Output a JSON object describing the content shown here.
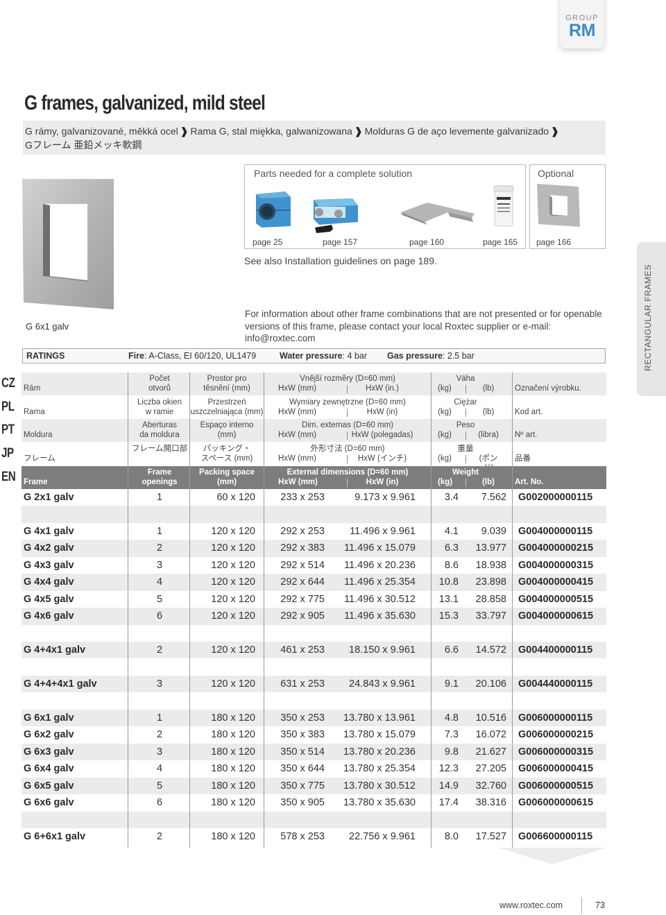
{
  "group_badge": {
    "label": "GROUP",
    "code": "RM"
  },
  "title": "G frames, galvanized, mild steel",
  "subtitle": {
    "segments": [
      "G rámy, galvanizované, měkká ocel",
      "Rama G, stal miękka, galwanizowana",
      "Molduras G de aço levemente galvanizado"
    ],
    "separator": "❱",
    "line2": "Gフレーム 亜鉛メッキ軟鋼"
  },
  "parts": {
    "title": "Parts needed for a complete solution",
    "items": [
      {
        "icon": "blue-block-module-icon",
        "page": "page 25"
      },
      {
        "icon": "blue-compression-unit-icon",
        "page": "page 157"
      },
      {
        "icon": "stayplate-icon",
        "page": "page 160"
      },
      {
        "icon": "lubricant-jar-icon",
        "page": "page 165"
      }
    ]
  },
  "optional": {
    "title": "Optional",
    "items": [
      {
        "icon": "weld-frame-icon",
        "page": "page 166"
      }
    ]
  },
  "frame_image_label": "G 6x1 galv",
  "see_also": "See also Installation guidelines on page 189.",
  "info_text": "For information about other frame combinations that are not presented or for openable versions of this frame, please contact your local Roxtec supplier or e-mail: info@roxtec.com",
  "ratings": {
    "label": "RATINGS",
    "fire_label": "Fire",
    "fire_value": ": A-Class, EI 60/120, UL1479",
    "water_label": "Water pressure",
    "water_value": ": 4 bar",
    "gas_label": "Gas pressure",
    "gas_value": ": 2.5 bar"
  },
  "side_tab": "RECTANGULAR FRAMES",
  "languages": [
    "CZ",
    "PL",
    "PT",
    "JP",
    "EN"
  ],
  "header_rows": [
    {
      "lang": "CZ",
      "frame": "Rám",
      "openings": [
        "Počet",
        "otvorů"
      ],
      "packing": [
        "Prostor pro",
        "těsnění (mm)"
      ],
      "ext_title": "Vnější rozměry (D=60 mm)",
      "ext_mm": "HxW (mm)",
      "ext_in": "HxW (in.)",
      "weight_title": "Váha",
      "kg": "(kg)",
      "lb": "(lb)",
      "art": "Označení výrobku."
    },
    {
      "lang": "PL",
      "frame": "Rama",
      "openings": [
        "Liczba okien",
        "w ramie"
      ],
      "packing": [
        "Przestrzeń",
        "uszczelniająca (mm)"
      ],
      "ext_title": "Wymiary zewnętrzne (D=60 mm)",
      "ext_mm": "HxW (mm)",
      "ext_in": "HxW (in)",
      "weight_title": "Ciężar",
      "kg": "(kg)",
      "lb": "(lb)",
      "art": "Kod art."
    },
    {
      "lang": "PT",
      "frame": "Moldura",
      "openings": [
        "Aberturas",
        "da moldura"
      ],
      "packing": [
        "Espaço interno",
        "(mm)"
      ],
      "ext_title": "Dim. externas (D=60 mm)",
      "ext_mm": "HxW (mm)",
      "ext_in": "HxW (polegadas)",
      "weight_title": "Peso",
      "kg": "(kg)",
      "lb": "(libra)",
      "art": "Nº art."
    },
    {
      "lang": "JP",
      "frame": "フレーム",
      "openings": [
        "",
        "フレーム開口部"
      ],
      "packing": [
        "パッキング・",
        "スペース (mm)"
      ],
      "ext_title": "外形寸法 (D=60 mm)",
      "ext_mm": "HxW (mm)",
      "ext_in": "HxW (インチ)",
      "weight_title": "重量",
      "kg": "(kg)",
      "lb": "(ポンド)",
      "art": "品番"
    },
    {
      "lang": "EN",
      "frame": "Frame",
      "openings": [
        "Frame",
        "openings"
      ],
      "packing": [
        "Packing space",
        "(mm)"
      ],
      "ext_title": "External dimensions (D=60 mm)",
      "ext_mm": "HxW (mm)",
      "ext_in": "HxW (in)",
      "weight_title": "Weight",
      "kg": "(kg)",
      "lb": "(lb)",
      "art": "Art. No."
    }
  ],
  "rows": [
    {
      "name": "G 2x1 galv",
      "openings": "1",
      "packing": "60 x 120",
      "mm": "233 x 253",
      "in": "9.173 x 9.961",
      "kg": "3.4",
      "lb": "7.562",
      "art": "G002000000115"
    },
    null,
    {
      "name": "G 4x1 galv",
      "openings": "1",
      "packing": "120 x 120",
      "mm": "292 x 253",
      "in": "11.496 x 9.961",
      "kg": "4.1",
      "lb": "9.039",
      "art": "G004000000115"
    },
    {
      "name": "G 4x2 galv",
      "openings": "2",
      "packing": "120 x 120",
      "mm": "292 x 383",
      "in": "11.496 x 15.079",
      "kg": "6.3",
      "lb": "13.977",
      "art": "G004000000215"
    },
    {
      "name": "G 4x3 galv",
      "openings": "3",
      "packing": "120 x 120",
      "mm": "292 x 514",
      "in": "11.496 x 20.236",
      "kg": "8.6",
      "lb": "18.938",
      "art": "G004000000315"
    },
    {
      "name": "G 4x4 galv",
      "openings": "4",
      "packing": "120 x 120",
      "mm": "292 x 644",
      "in": "11.496 x 25.354",
      "kg": "10.8",
      "lb": "23.898",
      "art": "G004000000415"
    },
    {
      "name": "G 4x5 galv",
      "openings": "5",
      "packing": "120 x 120",
      "mm": "292 x 775",
      "in": "11.496 x 30.512",
      "kg": "13.1",
      "lb": "28.858",
      "art": "G004000000515"
    },
    {
      "name": "G 4x6 galv",
      "openings": "6",
      "packing": "120 x 120",
      "mm": "292 x 905",
      "in": "11.496 x 35.630",
      "kg": "15.3",
      "lb": "33.797",
      "art": "G004000000615"
    },
    null,
    {
      "name": "G 4+4x1 galv",
      "openings": "2",
      "packing": "120 x 120",
      "mm": "461 x 253",
      "in": "18.150 x 9.961",
      "kg": "6.6",
      "lb": "14.572",
      "art": "G004400000115"
    },
    null,
    {
      "name": "G 4+4+4x1 galv",
      "openings": "3",
      "packing": "120 x 120",
      "mm": "631 x 253",
      "in": "24.843 x 9.961",
      "kg": "9.1",
      "lb": "20.106",
      "art": "G004440000115"
    },
    null,
    {
      "name": "G 6x1 galv",
      "openings": "1",
      "packing": "180 x 120",
      "mm": "350 x 253",
      "in": "13.780 x 13.961",
      "kg": "4.8",
      "lb": "10.516",
      "art": "G006000000115"
    },
    {
      "name": "G 6x2 galv",
      "openings": "2",
      "packing": "180 x 120",
      "mm": "350 x 383",
      "in": "13.780 x 15.079",
      "kg": "7.3",
      "lb": "16.072",
      "art": "G006000000215"
    },
    {
      "name": "G 6x3 galv",
      "openings": "3",
      "packing": "180 x 120",
      "mm": "350 x 514",
      "in": "13.780 x 20.236",
      "kg": "9.8",
      "lb": "21.627",
      "art": "G006000000315"
    },
    {
      "name": "G 6x4 galv",
      "openings": "4",
      "packing": "180 x 120",
      "mm": "350 x 644",
      "in": "13.780 x 25.354",
      "kg": "12.3",
      "lb": "27.205",
      "art": "G006000000415"
    },
    {
      "name": "G 6x5 galv",
      "openings": "5",
      "packing": "180 x 120",
      "mm": "350 x 775",
      "in": "13.780 x 30.512",
      "kg": "14.9",
      "lb": "32.760",
      "art": "G006000000515"
    },
    {
      "name": "G 6x6 galv",
      "openings": "6",
      "packing": "180 x 120",
      "mm": "350 x 905",
      "in": "13.780 x 35.630",
      "kg": "17.4",
      "lb": "38.316",
      "art": "G006000000615"
    },
    null,
    {
      "name": "G 6+6x1 galv",
      "openings": "2",
      "packing": "180 x 120",
      "mm": "578 x 253",
      "in": "22.756 x 9.961",
      "kg": "8.0",
      "lb": "17.527",
      "art": "G006600000115"
    }
  ],
  "footer": {
    "url": "www.roxtec.com",
    "page": "73"
  }
}
